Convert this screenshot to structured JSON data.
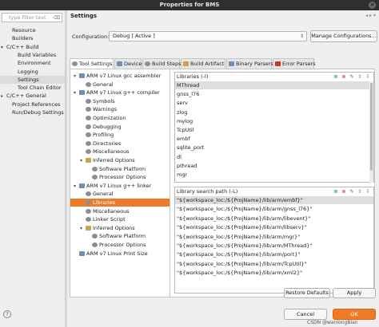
{
  "window": {
    "title": "Properties for BMS",
    "close": "×"
  },
  "left": {
    "filter_placeholder": "type filter text",
    "nav": [
      {
        "twisty": "",
        "label": "Resource"
      },
      {
        "twisty": "",
        "label": "Builders"
      },
      {
        "twisty": "▾",
        "label": "C/C++ Build"
      },
      {
        "twisty": "",
        "label": "Build Variables"
      },
      {
        "twisty": "",
        "label": "Environment"
      },
      {
        "twisty": "",
        "label": "Logging"
      },
      {
        "twisty": "",
        "label": "Settings",
        "selected": true
      },
      {
        "twisty": "",
        "label": "Tool Chain Editor"
      },
      {
        "twisty": "▸",
        "label": "C/C++ General"
      },
      {
        "twisty": "",
        "label": "Project References"
      },
      {
        "twisty": "",
        "label": "Run/Debug Settings"
      }
    ]
  },
  "main": {
    "title": "Settings",
    "config_label": "Configuration:",
    "config_value": "Debug [ Active ]",
    "manage_button": "Manage Configurations...",
    "tabs": [
      "Tool Settings",
      "Devices",
      "Build Steps",
      "Build Artifact",
      "Binary Parsers",
      "Error Parsers"
    ],
    "tree": [
      {
        "twisty": "▾",
        "icon": "arm",
        "label": "ARM v7 Linux gcc assembler"
      },
      {
        "twisty": "",
        "icon": "gear",
        "label": "General"
      },
      {
        "twisty": "▾",
        "icon": "arm",
        "label": "ARM v7 Linux g++ compiler"
      },
      {
        "twisty": "",
        "icon": "gear",
        "label": "Symbols"
      },
      {
        "twisty": "",
        "icon": "gear",
        "label": "Warnings"
      },
      {
        "twisty": "",
        "icon": "gear",
        "label": "Optimization"
      },
      {
        "twisty": "",
        "icon": "gear",
        "label": "Debugging"
      },
      {
        "twisty": "",
        "icon": "gear",
        "label": "Profiling"
      },
      {
        "twisty": "",
        "icon": "gear",
        "label": "Directories"
      },
      {
        "twisty": "",
        "icon": "gear",
        "label": "Miscellaneous"
      },
      {
        "twisty": "▾",
        "icon": "fold",
        "label": "Inferred Options"
      },
      {
        "twisty": "",
        "icon": "gear",
        "label": "Software Platform"
      },
      {
        "twisty": "",
        "icon": "gear",
        "label": "Processor Options"
      },
      {
        "twisty": "▾",
        "icon": "arm",
        "label": "ARM v7 Linux g++ linker"
      },
      {
        "twisty": "",
        "icon": "gear",
        "label": "General"
      },
      {
        "twisty": "",
        "icon": "gear",
        "label": "Libraries",
        "selected": true
      },
      {
        "twisty": "",
        "icon": "gear",
        "label": "Miscellaneous"
      },
      {
        "twisty": "",
        "icon": "gear",
        "label": "Linker Script"
      },
      {
        "twisty": "▾",
        "icon": "fold",
        "label": "Inferred Options"
      },
      {
        "twisty": "",
        "icon": "gear",
        "label": "Software Platform"
      },
      {
        "twisty": "",
        "icon": "gear",
        "label": "Processor Options"
      },
      {
        "twisty": "",
        "icon": "arm",
        "label": "ARM v7 Linux Print Size"
      }
    ],
    "libraries": {
      "header": "Libraries (-l)",
      "items": [
        "MThread",
        "gnss_l76",
        "serv",
        "zlog",
        "mylog",
        "TcpUtil",
        "embf",
        "sqlite_port",
        "dl",
        "pthread",
        "mgr"
      ]
    },
    "libpaths": {
      "header": "Library search path (-L)",
      "items": [
        "\"${workspace_loc:/${ProjName}/lib/arm/embf}\"",
        "\"${workspace_loc:/${ProjName}/lib/arm/gnss_l76}\"",
        "\"${workspace_loc:/${ProjName}/lib/arm/libevent}\"",
        "\"${workspace_loc:/${ProjName}/lib/arm/libserv}\"",
        "\"${workspace_loc:/${ProjName}/lib/arm/mgr}\"",
        "\"${workspace_loc:/${ProjName}/lib/arm/MThread}\"",
        "\"${workspace_loc:/${ProjName}/lib/arm/port}\"",
        "\"${workspace_loc:/${ProjName}/lib/arm/TcpUtil}\"",
        "\"${workspace_loc:/${ProjName}/lib/arm/xml2}\""
      ]
    },
    "restore_button": "Restore Defaults",
    "apply_button": "Apply",
    "cancel_button": "Cancel",
    "ok_button": "OK",
    "watermark": "CSDN @wanlongBian"
  },
  "colors": {
    "accent": "#f07b27",
    "title_bg": "#2f2f2f"
  },
  "icons": [
    "close-icon",
    "help-icon",
    "add-icon",
    "delete-icon",
    "edit-icon",
    "move-up-icon",
    "move-down-icon"
  ]
}
